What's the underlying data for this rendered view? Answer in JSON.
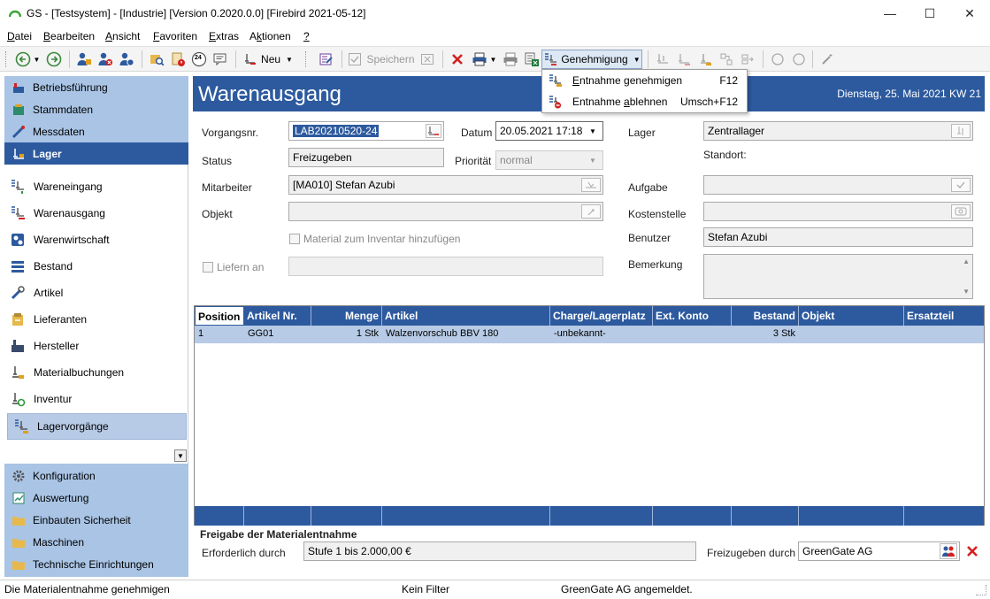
{
  "window": {
    "title": "GS - [Testsystem] - [Industrie]  [Version  0.2020.0.0]  [Firebird 2021-05-12]",
    "minimize": "—",
    "maximize": "☐",
    "close": "✕"
  },
  "menu": [
    {
      "pre": "",
      "u": "D",
      "post": "atei"
    },
    {
      "pre": "",
      "u": "B",
      "post": "earbeiten"
    },
    {
      "pre": "",
      "u": "A",
      "post": "nsicht"
    },
    {
      "pre": "",
      "u": "F",
      "post": "avoriten"
    },
    {
      "pre": "",
      "u": "E",
      "post": "xtras"
    },
    {
      "pre": "A",
      "u": "k",
      "post": "tionen"
    },
    {
      "pre": "",
      "u": "?",
      "post": ""
    }
  ],
  "toolbar": {
    "new_label": "Neu",
    "save_label": "Speichern",
    "approval_label": "Genehmigung",
    "badge_24": "24"
  },
  "dropdown": {
    "items": [
      {
        "pre": "",
        "u": "E",
        "post": "ntnahme genehmigen",
        "shortcut": "F12"
      },
      {
        "pre": "Entnahme ",
        "u": "a",
        "post": "blehnen",
        "shortcut": "Umsch+F12"
      }
    ]
  },
  "sidebar": {
    "top": [
      "Betriebsführung",
      "Stammdaten",
      "Messdaten",
      "Lager"
    ],
    "items": [
      "Wareneingang",
      "Warenausgang",
      "Warenwirtschaft",
      "Bestand",
      "Artikel",
      "Lieferanten",
      "Hersteller",
      "Materialbuchungen",
      "Inventur",
      "Lagervorgänge"
    ],
    "bottom": [
      "Konfiguration",
      "Auswertung",
      "Einbauten Sicherheit",
      "Maschinen",
      "Technische Einrichtungen"
    ],
    "scroll_glyph": "▼"
  },
  "header": {
    "title": "Warenausgang",
    "date": "Dienstag, 25. Mai 2021  KW 21"
  },
  "form": {
    "vorgangsnr_label": "Vorgangsnr.",
    "vorgangsnr_value": "LAB20210520-24",
    "datum_label": "Datum",
    "datum_value": "20.05.2021 17:18",
    "status_label": "Status",
    "status_value": "Freizugeben",
    "prioritaet_label": "Priorität",
    "prioritaet_value": "normal",
    "mitarbeiter_label": "Mitarbeiter",
    "mitarbeiter_value": "[MA010] Stefan Azubi",
    "objekt_label": "Objekt",
    "objekt_value": "",
    "inventar_label": "Material zum Inventar hinzufügen",
    "liefern_label": "Liefern an",
    "lager_label": "Lager",
    "lager_value": "Zentrallager",
    "standort_label": "Standort:",
    "aufgabe_label": "Aufgabe",
    "kostenstelle_label": "Kostenstelle",
    "benutzer_label": "Benutzer",
    "benutzer_value": "Stefan Azubi",
    "bemerkung_label": "Bemerkung"
  },
  "grid": {
    "columns": [
      "Position",
      "Artikel Nr.",
      "Menge",
      "Artikel",
      "Charge/Lagerplatz",
      "Ext. Konto",
      "Bestand",
      "Objekt",
      "Ersatzteil"
    ],
    "rows": [
      [
        "1",
        "GG01",
        "1 Stk",
        "Walzenvorschub BBV 180",
        "-unbekannt-",
        "",
        "3 Stk",
        "",
        ""
      ]
    ]
  },
  "approval": {
    "section_title": "Freigabe der Materialentnahme",
    "required_label": "Erforderlich durch",
    "required_value": "Stufe 1 bis 2.000,00 €",
    "release_label": "Freizugeben durch",
    "release_value": "GreenGate AG"
  },
  "statusbar": {
    "left": "Die Materialentnahme genehmigen",
    "center": "Kein Filter",
    "right": "GreenGate AG angemeldet."
  },
  "colors": {
    "accent": "#2d5a9e",
    "sidebar": "#a9c4e5",
    "selected_row": "#b7cbe6",
    "delete_red": "#d42020"
  }
}
